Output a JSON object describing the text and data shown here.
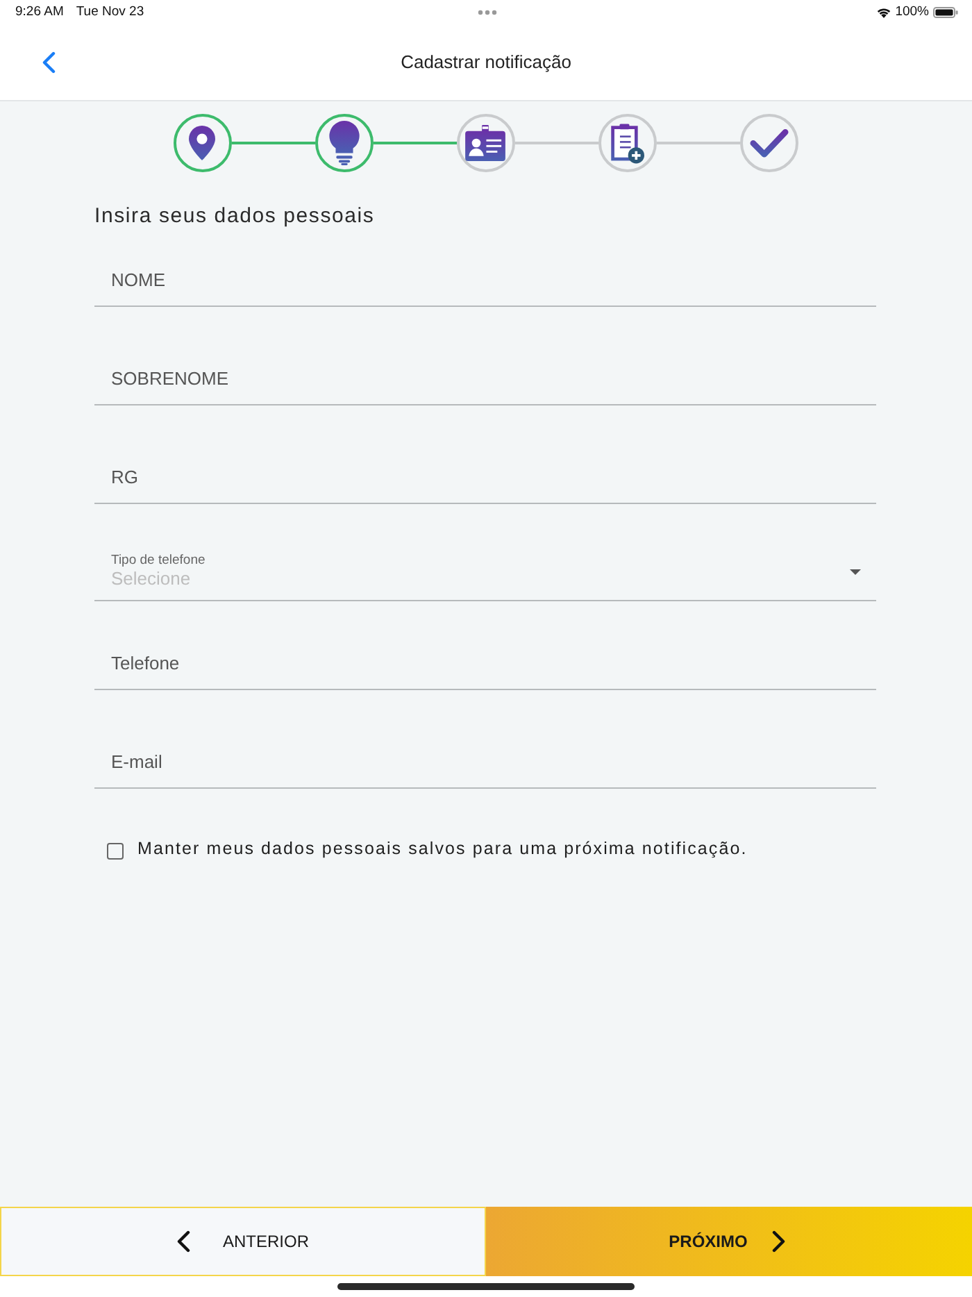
{
  "status_bar": {
    "time": "9:26 AM",
    "date": "Tue Nov 23",
    "battery": "100%"
  },
  "nav_bar": {
    "title": "Cadastrar notificação"
  },
  "steps": [
    {
      "kind": "location",
      "completed": true
    },
    {
      "kind": "idea",
      "completed": true
    },
    {
      "kind": "id_card",
      "completed": false
    },
    {
      "kind": "clipboard",
      "completed": false
    },
    {
      "kind": "check",
      "completed": false
    }
  ],
  "form": {
    "heading": "Insira seus dados pessoais",
    "fields": [
      {
        "kind": "text",
        "placeholder": "NOME"
      },
      {
        "kind": "text",
        "placeholder": "SOBRENOME"
      },
      {
        "kind": "text",
        "placeholder": "RG"
      },
      {
        "kind": "select",
        "label": "Tipo de telefone",
        "placeholder": "Selecione"
      },
      {
        "kind": "text",
        "placeholder": "Telefone"
      },
      {
        "kind": "text",
        "placeholder": "E-mail"
      }
    ],
    "keep_data": {
      "label": "Manter meus dados pessoais salvos para uma próxima notificação.",
      "checked": false
    }
  },
  "footer": {
    "previous": "ANTERIOR",
    "next": "PRÓXIMO"
  }
}
